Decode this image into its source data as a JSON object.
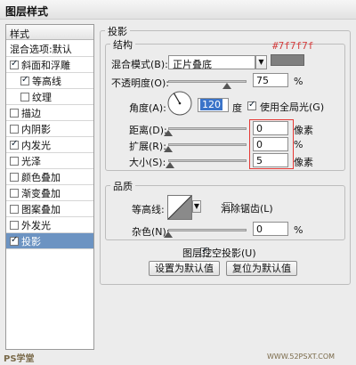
{
  "window": {
    "title": "图层样式"
  },
  "sidebar": {
    "header": "样式",
    "items": [
      {
        "label": "混合选项:默认",
        "has_checkbox": false,
        "checked": false,
        "indent": false,
        "selected": false
      },
      {
        "label": "斜面和浮雕",
        "has_checkbox": true,
        "checked": true,
        "indent": false,
        "selected": false
      },
      {
        "label": "等高线",
        "has_checkbox": true,
        "checked": true,
        "indent": true,
        "selected": false
      },
      {
        "label": "纹理",
        "has_checkbox": true,
        "checked": false,
        "indent": true,
        "selected": false
      },
      {
        "label": "描边",
        "has_checkbox": true,
        "checked": false,
        "indent": false,
        "selected": false
      },
      {
        "label": "内阴影",
        "has_checkbox": true,
        "checked": false,
        "indent": false,
        "selected": false
      },
      {
        "label": "内发光",
        "has_checkbox": true,
        "checked": true,
        "indent": false,
        "selected": false
      },
      {
        "label": "光泽",
        "has_checkbox": true,
        "checked": false,
        "indent": false,
        "selected": false
      },
      {
        "label": "颜色叠加",
        "has_checkbox": true,
        "checked": false,
        "indent": false,
        "selected": false
      },
      {
        "label": "渐变叠加",
        "has_checkbox": true,
        "checked": false,
        "indent": false,
        "selected": false
      },
      {
        "label": "图案叠加",
        "has_checkbox": true,
        "checked": false,
        "indent": false,
        "selected": false
      },
      {
        "label": "外发光",
        "has_checkbox": true,
        "checked": false,
        "indent": false,
        "selected": false
      },
      {
        "label": "投影",
        "has_checkbox": true,
        "checked": true,
        "indent": false,
        "selected": true
      }
    ]
  },
  "panel": {
    "title": "投影",
    "structure": {
      "title": "结构",
      "blend_mode": {
        "label": "混合模式(B):",
        "value": "正片叠底",
        "color_note": "#7f7f7f",
        "swatch_color": "#7f7f7f"
      },
      "opacity": {
        "label": "不透明度(O):",
        "value": "75",
        "unit": "%",
        "fraction": 0.75
      },
      "angle": {
        "label": "角度(A):",
        "value": "120",
        "unit": "度",
        "global_light_label": "使用全局光(G)",
        "global_light_checked": true
      },
      "distance": {
        "label": "距离(D):",
        "value": "0",
        "unit": "像素",
        "fraction": 0.0
      },
      "spread": {
        "label": "扩展(R):",
        "value": "0",
        "unit": "%",
        "fraction": 0.0
      },
      "size": {
        "label": "大小(S):",
        "value": "5",
        "unit": "像素",
        "fraction": 0.02
      }
    },
    "quality": {
      "title": "品质",
      "contour_label": "等高线:",
      "anti_alias_label": "消除锯齿(L)",
      "anti_alias_checked": false,
      "noise": {
        "label": "杂色(N):",
        "value": "0",
        "unit": "%",
        "fraction": 0.0
      }
    },
    "knockout": {
      "label": "图层挖空投影(U)",
      "checked": true
    },
    "buttons": {
      "set_default": "设置为默认值",
      "reset_default": "复位为默认值"
    }
  },
  "watermarks": {
    "left": "PS学堂",
    "right": "WWW.52PSXT.COM"
  },
  "colors": {
    "selection": "#6c93c2",
    "highlight_box": "#e53935",
    "annotation": "#d43c3c"
  }
}
